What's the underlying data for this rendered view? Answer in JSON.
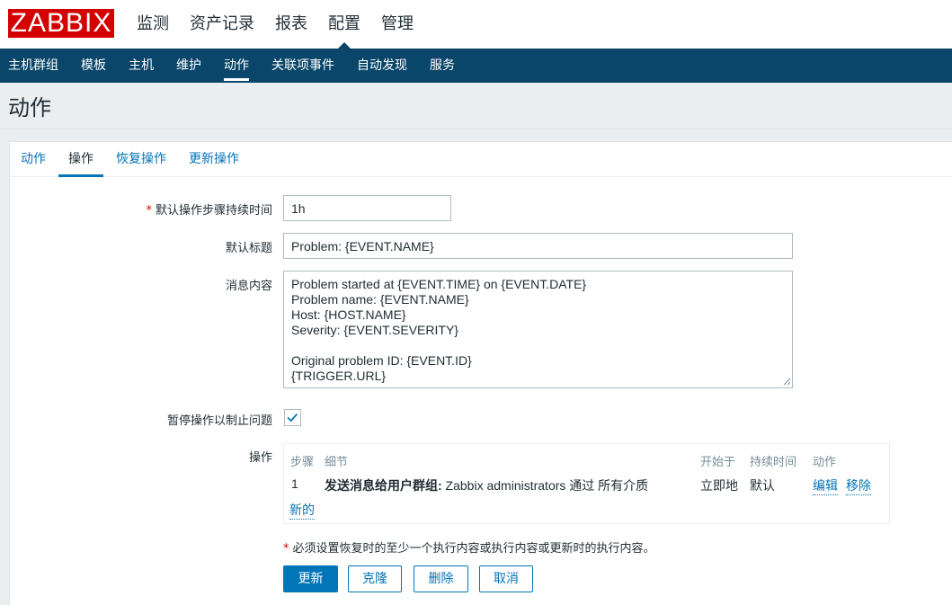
{
  "header": {
    "logo_text": "ZABBIX",
    "menu": [
      {
        "label": "监测"
      },
      {
        "label": "资产记录"
      },
      {
        "label": "报表"
      },
      {
        "label": "配置"
      },
      {
        "label": "管理"
      }
    ],
    "selected_index": 3
  },
  "subnav": {
    "items": [
      {
        "label": "主机群组"
      },
      {
        "label": "模板"
      },
      {
        "label": "主机"
      },
      {
        "label": "维护"
      },
      {
        "label": "动作"
      },
      {
        "label": "关联项事件"
      },
      {
        "label": "自动发现"
      },
      {
        "label": "服务"
      }
    ],
    "selected_index": 4
  },
  "page": {
    "title": "动作"
  },
  "tabs": [
    {
      "label": "动作"
    },
    {
      "label": "操作"
    },
    {
      "label": "恢复操作"
    },
    {
      "label": "更新操作"
    }
  ],
  "form": {
    "step_duration": {
      "label": "默认操作步骤持续时间",
      "value": "1h",
      "required_mark": "*"
    },
    "default_subject": {
      "label": "默认标题",
      "value": "Problem: {EVENT.NAME}"
    },
    "default_message": {
      "label": "消息内容",
      "value": "Problem started at {EVENT.TIME} on {EVENT.DATE}\nProblem name: {EVENT.NAME}\nHost: {HOST.NAME}\nSeverity: {EVENT.SEVERITY}\n\nOriginal problem ID: {EVENT.ID}\n{TRIGGER.URL}"
    },
    "pause_suppressed": {
      "label": "暂停操作以制止问题",
      "checked": true
    },
    "operations": {
      "label": "操作",
      "columns": {
        "step": "步骤",
        "details": "细节",
        "start_in": "开始于",
        "duration": "持续时间",
        "action": "动作"
      },
      "rows": [
        {
          "step": "1",
          "details_bold": "发送消息给用户群组:",
          "details_rest": " Zabbix administrators 通过 所有介质",
          "start_in": "立即地",
          "duration": "默认",
          "edit": "编辑",
          "remove": "移除"
        }
      ],
      "new_link": "新的"
    },
    "note": {
      "mark": "*",
      "text": "必须设置恢复时的至少一个执行内容或执行内容或更新时的执行内容。"
    }
  },
  "buttons": {
    "update": "更新",
    "clone": "克隆",
    "delete": "删除",
    "cancel": "取消"
  },
  "colors": {
    "brand_red": "#d40000",
    "nav_dark": "#0a466a",
    "link_blue": "#0275b8"
  },
  "icons": {
    "checkbox": "checkmark-icon",
    "textarea": "resize-grip-icon"
  }
}
